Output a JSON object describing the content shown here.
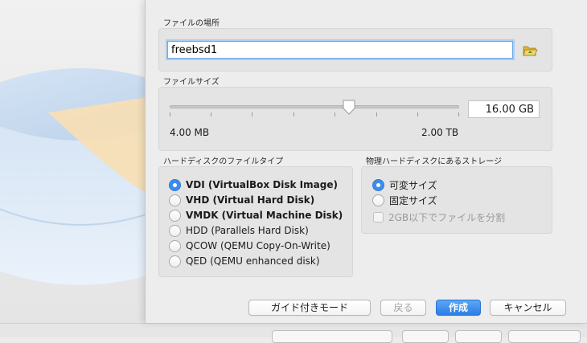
{
  "file_location": {
    "title": "ファイルの場所",
    "name_value": "freebsd1",
    "folder_icon": "folder-open-icon"
  },
  "file_size": {
    "title": "ファイルサイズ",
    "value": "16.00 GB",
    "slider_fraction": 0.62,
    "min_label": "4.00 MB",
    "max_label": "2.00 TB"
  },
  "disk_type": {
    "title": "ハードディスクのファイルタイプ",
    "options": [
      {
        "label": "VDI (VirtualBox Disk Image)",
        "selected": true
      },
      {
        "label": "VHD (Virtual Hard Disk)",
        "selected": false
      },
      {
        "label": "VMDK (Virtual Machine Disk)",
        "selected": false
      },
      {
        "label": "HDD (Parallels Hard Disk)",
        "selected": false
      },
      {
        "label": "QCOW (QEMU Copy-On-Write)",
        "selected": false
      },
      {
        "label": "QED (QEMU enhanced disk)",
        "selected": false
      }
    ]
  },
  "storage": {
    "title": "物理ハードディスクにあるストレージ",
    "options": [
      {
        "label": "可変サイズ",
        "selected": true
      },
      {
        "label": "固定サイズ",
        "selected": false
      }
    ],
    "split_checkbox": {
      "label": "2GB以下でファイルを分割",
      "checked": false,
      "enabled": false
    }
  },
  "buttons": {
    "guided": "ガイド付きモード",
    "back": "戻る",
    "create": "作成",
    "cancel": "キャンセル"
  },
  "colors": {
    "accent": "#3b8ef0",
    "primary_button": "#2c7de6"
  }
}
